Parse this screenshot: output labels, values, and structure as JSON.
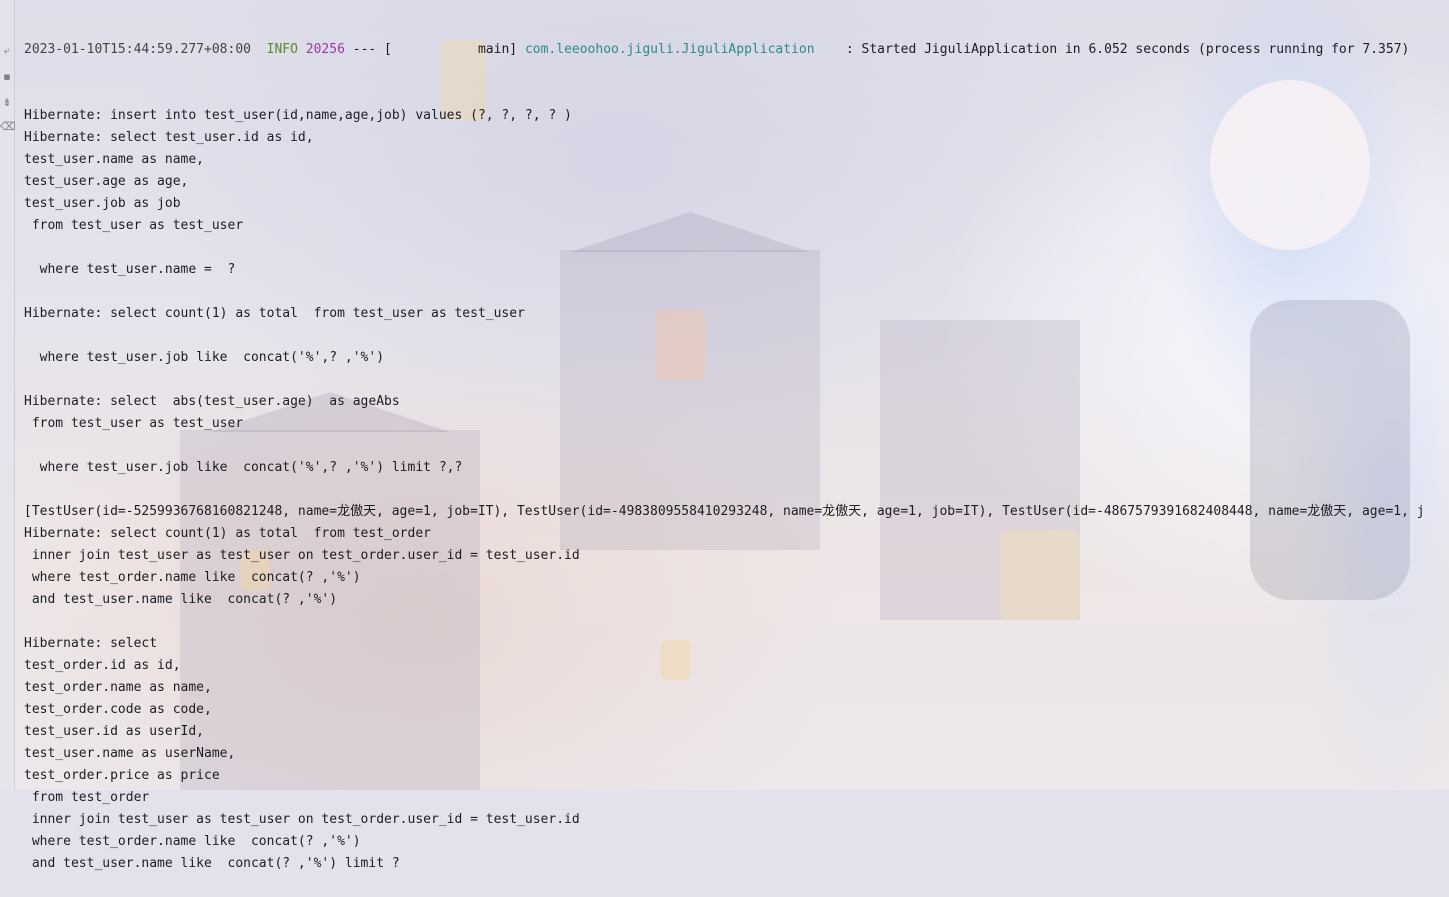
{
  "gutter": {
    "icons": [
      {
        "name": "soft-wrap-icon",
        "glyph": "⤶"
      },
      {
        "name": "print-icon",
        "glyph": "▪"
      },
      {
        "name": "pin-icon",
        "glyph": "⇟"
      },
      {
        "name": "delete-icon",
        "glyph": "⌫"
      }
    ]
  },
  "colors": {
    "log_level_info": "#5c8a2c",
    "process_id": "#9b3aa3",
    "logger_name": "#2c8a8a"
  },
  "console": {
    "startup_line": {
      "timestamp": "2023-01-10T15:44:59.277+08:00",
      "level": "  INFO ",
      "pid": "20256",
      "thread": " --- [           main] ",
      "logger": "com.leeoohoo.jiguli.JiguliApplication",
      "message": "    : Started JiguliApplication in 6.052 seconds (process running for 7.357)"
    },
    "lines": [
      "Hibernate: insert into test_user(id,name,age,job) values (?, ?, ?, ? )",
      "Hibernate: select test_user.id as id,",
      "test_user.name as name,",
      "test_user.age as age,",
      "test_user.job as job",
      " from test_user as test_user",
      "",
      "  where test_user.name =  ?",
      "",
      "Hibernate: select count(1) as total  from test_user as test_user",
      "",
      "  where test_user.job like  concat('%',? ,'%')",
      "",
      "Hibernate: select  abs(test_user.age)  as ageAbs",
      " from test_user as test_user",
      "",
      "  where test_user.job like  concat('%',? ,'%') limit ?,?",
      "",
      "[TestUser(id=-5259936768160821248, name=龙傲天, age=1, job=IT), TestUser(id=-4983809558410293248, name=龙傲天, age=1, job=IT), TestUser(id=-4867579391682408448, name=龙傲天, age=1, j",
      "Hibernate: select count(1) as total  from test_order",
      " inner join test_user as test_user on test_order.user_id = test_user.id",
      " where test_order.name like  concat(? ,'%')",
      " and test_user.name like  concat(? ,'%')",
      "",
      "Hibernate: select",
      "test_order.id as id,",
      "test_order.name as name,",
      "test_order.code as code,",
      "test_user.id as userId,",
      "test_user.name as userName,",
      "test_order.price as price",
      " from test_order",
      " inner join test_user as test_user on test_order.user_id = test_user.id",
      " where test_order.name like  concat(? ,'%')",
      " and test_user.name like  concat(? ,'%') limit ?"
    ]
  }
}
